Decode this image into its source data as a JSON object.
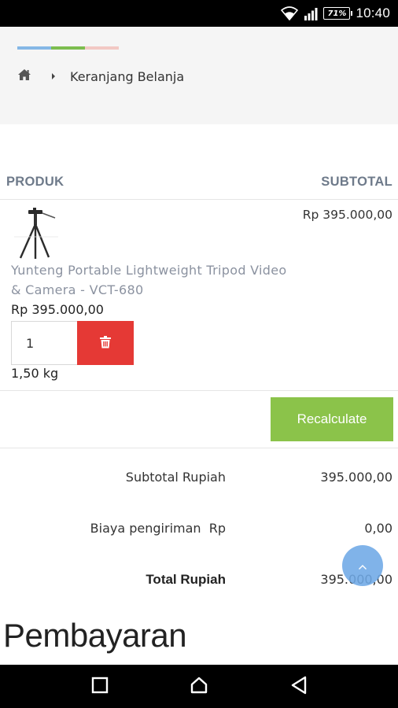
{
  "status_bar": {
    "battery": "71%",
    "time": "10:40",
    "icons": [
      "wifi-icon",
      "signal-icon",
      "battery-icon"
    ]
  },
  "header": {
    "stripes": [
      "#85b7e6",
      "#7cbd4f",
      "#f2c8c4"
    ],
    "breadcrumb": {
      "home_icon": "home-icon",
      "separator_icon": "caret-right-icon",
      "current": "Keranjang Belanja"
    }
  },
  "table": {
    "headers": {
      "product": "PRODUK",
      "subtotal": "SUBTOTAL"
    },
    "items": [
      {
        "name": "Yunteng Portable Lightweight Tripod Video & Camera - VCT-680",
        "price": "Rp 395.000,00",
        "quantity": "1",
        "weight": "1,50 kg",
        "subtotal": "Rp 395.000,00",
        "image_icon": "tripod-image",
        "delete_icon": "trash-icon"
      }
    ]
  },
  "actions": {
    "recalculate": "Recalculate"
  },
  "totals": {
    "subtotal_label": "Subtotal Rupiah",
    "subtotal_value": "395.000,00",
    "shipping_label": "Biaya pengiriman  Rp",
    "shipping_value": "0,00",
    "total_label": "Total Rupiah",
    "total_value": "395.000,00"
  },
  "payment": {
    "heading": "Pembayaran"
  },
  "colors": {
    "accent_green": "#8bc34a",
    "delete_red": "#e53935",
    "fab_blue": "#6ea8e6",
    "header_gray": "#6e7a8a"
  },
  "nav_bar": {
    "icons": [
      "recents-icon",
      "home-nav-icon",
      "back-icon"
    ]
  }
}
